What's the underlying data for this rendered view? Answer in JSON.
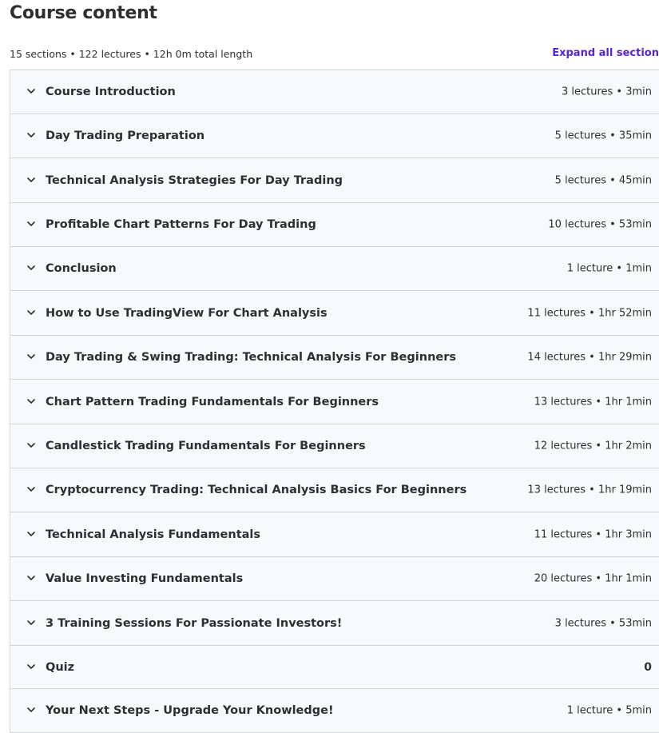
{
  "header": {
    "title": "Course content",
    "summary": "15 sections • 122 lectures • 12h 0m total length",
    "expand_label": "Expand all section"
  },
  "sections": [
    {
      "title": "Course Introduction",
      "meta": "3 lectures • 3min"
    },
    {
      "title": "Day Trading Preparation",
      "meta": "5 lectures • 35min"
    },
    {
      "title": "Technical Analysis Strategies For Day Trading",
      "meta": "5 lectures • 45min"
    },
    {
      "title": "Profitable Chart Patterns For Day Trading",
      "meta": "10 lectures • 53min"
    },
    {
      "title": "Conclusion",
      "meta": "1 lecture • 1min"
    },
    {
      "title": "How to Use TradingView For Chart Analysis",
      "meta": "11 lectures • 1hr 52min"
    },
    {
      "title": "Day Trading & Swing Trading: Technical Analysis For Beginners",
      "meta": "14 lectures • 1hr 29min"
    },
    {
      "title": "Chart Pattern Trading Fundamentals For Beginners",
      "meta": "13 lectures • 1hr 1min"
    },
    {
      "title": "Candlestick Trading Fundamentals For Beginners",
      "meta": "12 lectures • 1hr 2min"
    },
    {
      "title": "Cryptocurrency Trading: Technical Analysis Basics For Beginners",
      "meta": "13 lectures • 1hr 19min"
    },
    {
      "title": "Technical Analysis Fundamentals",
      "meta": "11 lectures • 1hr 3min"
    },
    {
      "title": "Value Investing Fundamentals",
      "meta": "20 lectures • 1hr 1min"
    },
    {
      "title": "3 Training Sessions For Passionate Investors!",
      "meta": "3 lectures • 53min"
    },
    {
      "title": "Quiz",
      "meta": "0"
    },
    {
      "title": "Your Next Steps - Upgrade Your Knowledge!",
      "meta": "1 lecture • 5min"
    }
  ],
  "colors": {
    "accent": "#5624d0",
    "row_bg": "#f7f9fa",
    "border": "#d1d7dc",
    "text": "#2d2f31"
  },
  "icons": {
    "section_toggle": "chevron-down-icon"
  }
}
